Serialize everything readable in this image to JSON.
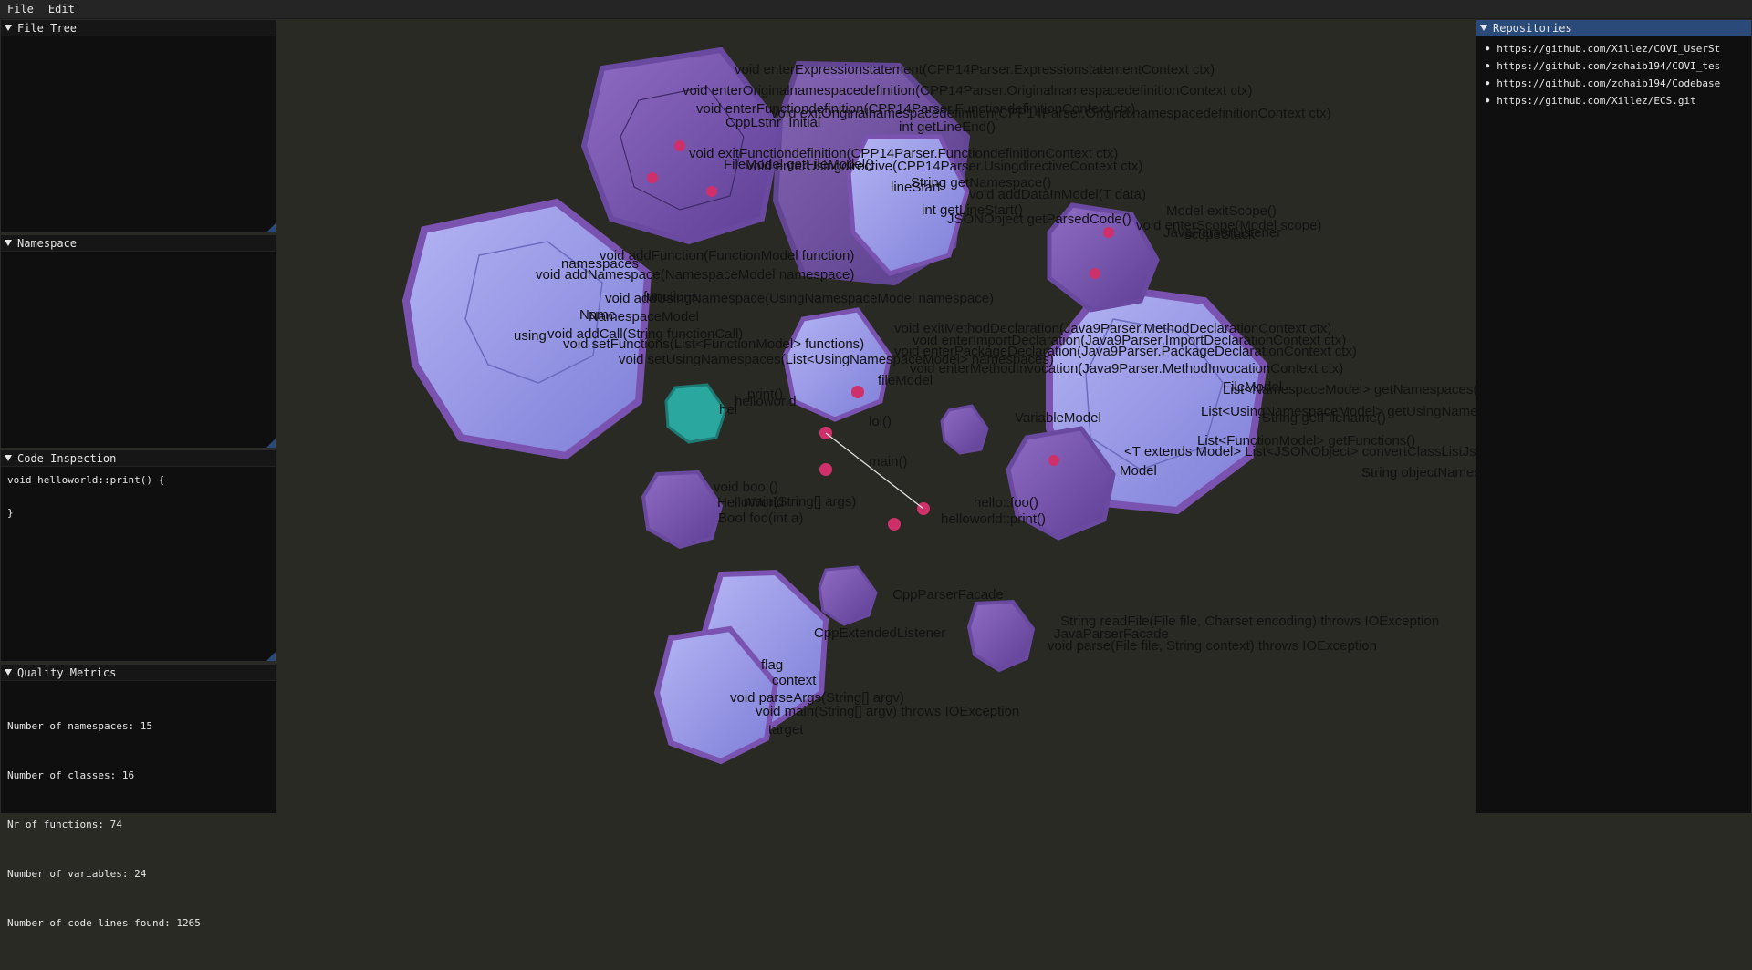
{
  "menu": {
    "file": "File",
    "edit": "Edit"
  },
  "panels": {
    "file_tree": {
      "title": "File Tree"
    },
    "namespace": {
      "title": "Namespace"
    },
    "code_inspection": {
      "title": "Code Inspection",
      "code": "void helloworld::print() {\n\n}"
    },
    "quality_metrics": {
      "title": "Quality Metrics",
      "lines": [
        "Number of namespaces: 15",
        "Number of classes: 16",
        "Nr of functions: 74",
        "Number of variables: 24",
        "Number of code lines found: 1265"
      ]
    },
    "repositories": {
      "title": "Repositories",
      "items": [
        "https://github.com/Xillez/COVI_UserSt",
        "https://github.com/zohaib194/COVI_tes",
        "https://github.com/zohaib194/Codebase",
        "https://github.com/Xillez/ECS.git"
      ]
    }
  },
  "scene_labels": [
    "void enterExpressionstatement(CPP14Parser.ExpressionstatementContext ctx)",
    "void enterOriginalnamespacedefinition(CPP14Parser.OriginalnamespacedefinitionContext ctx)",
    "void enterFunctiondefinition(CPP14Parser.FunctiondefinitionContext ctx)",
    "void exitOriginalnamespacedefinition(CPP14Parser.OriginalnamespacedefinitionContext ctx)",
    "CppLstnr_Initial",
    "int getLineEnd()",
    "void exitFunctiondefinition(CPP14Parser.FunctiondefinitionContext ctx)",
    "FileModel getFileModel()",
    "void enterUsingdirective(CPP14Parser.UsingdirectiveContext ctx)",
    "String getNamespace()",
    "lineStart",
    "void addDataInModel(T data)",
    "int getLineStart()",
    "JSONObject getParsedCode()",
    "Model exitScope()",
    "void enterScope(Model scope)",
    "JavaParserListener",
    "scopeStack",
    "void addFunction(FunctionModel function)",
    "namespaces",
    "void addNamespace(NamespaceModel namespace)",
    "void addUsingNamespace(UsingNamespaceModel namespace)",
    "functions",
    "Name",
    "NamespaceModel",
    "using",
    "void addCall(String functionCall)",
    "void setFunctions(List<FunctionModel> functions)",
    "void setUsingNamespaces(List<UsingNamespaceModel> namespaces)",
    "void exitMethodDeclaration(Java9Parser.MethodDeclarationContext ctx)",
    "void enterPackageDeclaration(Java9Parser.PackageDeclarationContext ctx)",
    "void enterImportDeclaration(Java9Parser.ImportDeclarationContext ctx)",
    "void enterMethodInvocation(Java9Parser.MethodInvocationContext ctx)",
    "fileModel",
    "FileModel",
    "List<NamespaceModel> getNamespaces()",
    "List<UsingNamespaceModel> getUsingNamespaces()",
    "String getFilename()",
    "List<FunctionModel> getFunctions()",
    "<T extends Model> List<JSONObject> convertClassListJsonObjectList(List<T> objectList,",
    "String objectNames)",
    "Model",
    "print()",
    "helloworld",
    "hel",
    "lol()",
    "main()",
    "VariableModel",
    "void boo ()",
    "HelloWorld",
    "main(String[] args)",
    "Bool foo(int a)",
    "hello::foo()",
    "helloworld::print()",
    "CppParserFacade",
    "CppExtendedListener",
    "String readFile(File file, Charset encoding) throws IOException",
    "JavaParserFacade",
    "void parse(File file, String context) throws IOException",
    "flag",
    "context",
    "void parseArgs(String[] argv)",
    "void main(String[] argv) throws IOException",
    "target"
  ],
  "colors": {
    "class_fill": "#9a9ae0",
    "class_edge": "#6a4aa0",
    "ns_fill": "#8060b0",
    "teal": "#2aa8a0",
    "func_node": "#d0306a"
  }
}
